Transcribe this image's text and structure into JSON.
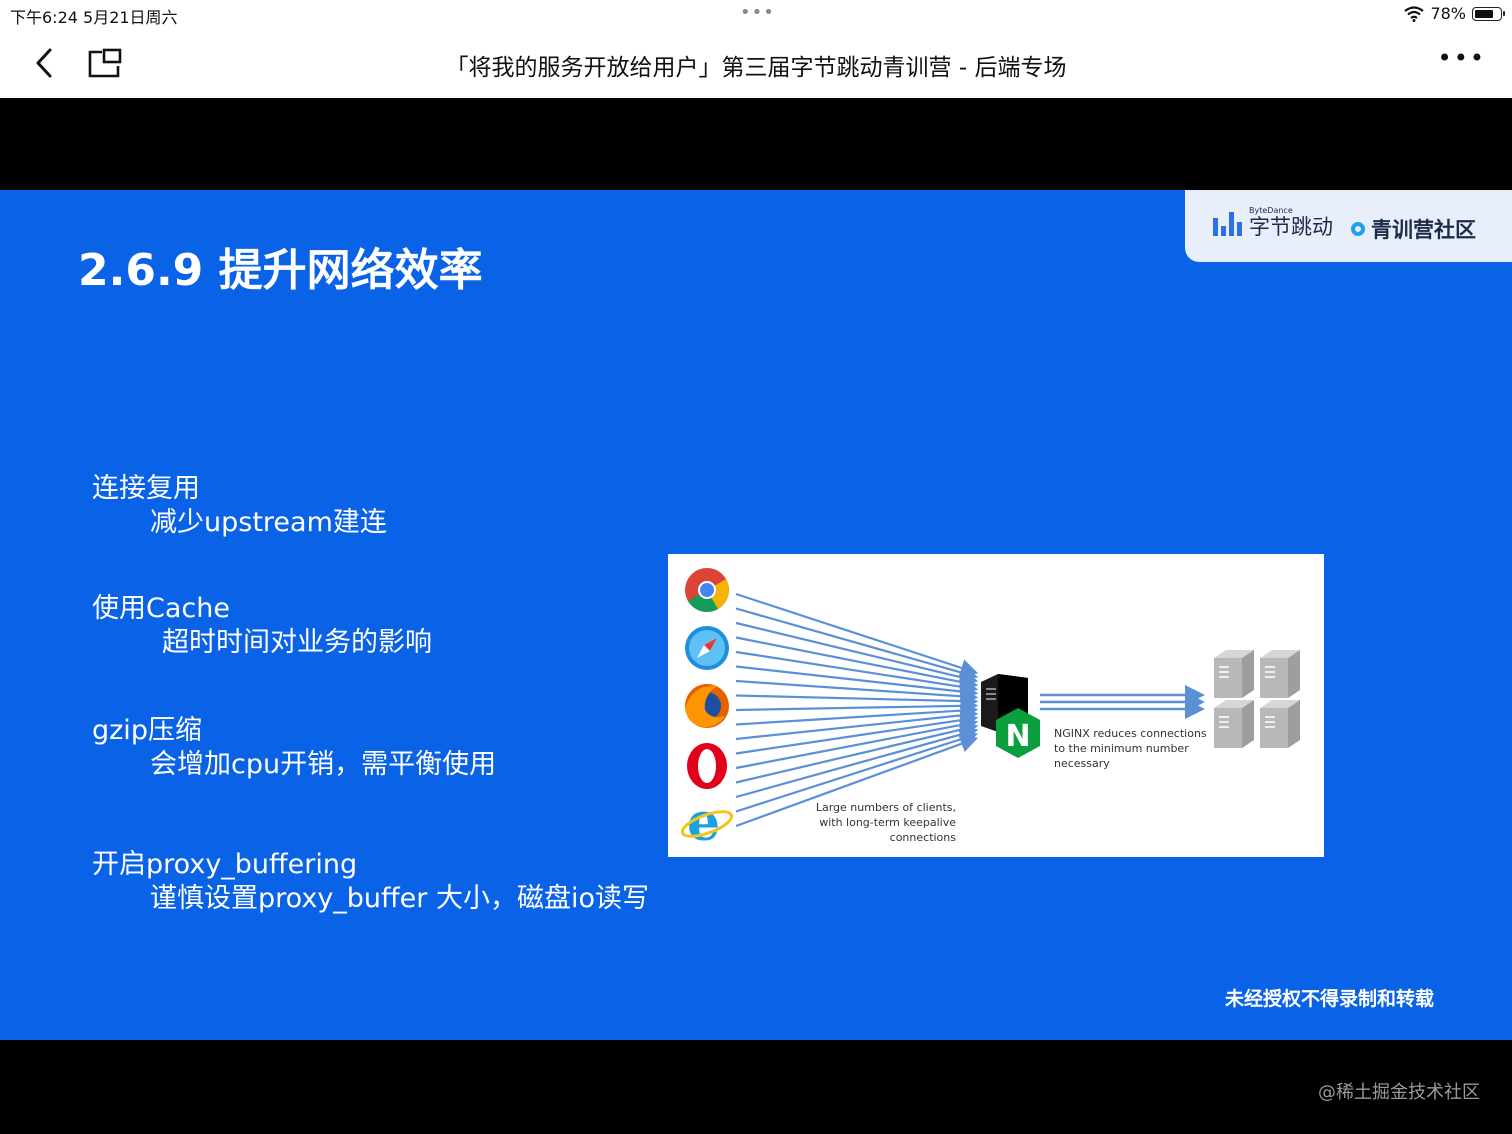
{
  "status_bar": {
    "time": "下午6:24   5月21日周六",
    "battery": "78%",
    "battery_level": 0.78
  },
  "nav": {
    "title": "「将我的服务开放给用户」第三届字节跳动青训营 - 后端专场",
    "back_icon": "chevron-left-icon",
    "pip_icon": "picture-in-picture-icon",
    "more_icon": "more-dots-icon"
  },
  "slide": {
    "title": "2.6.9 提升网络效率",
    "brand": {
      "bytedance_en": "ByteDance",
      "bytedance_cn": "字节跳动",
      "community": "青训营社区"
    },
    "items": [
      {
        "heading": "连接复用",
        "detail": "减少upstream建连"
      },
      {
        "heading": "使用Cache",
        "detail": "超时时间对业务的影响"
      },
      {
        "heading": "gzip压缩",
        "detail": "会增加cpu开销，需平衡使用"
      },
      {
        "heading": "开启proxy_buffering",
        "detail": "谨慎设置proxy_buffer 大小，磁盘io读写"
      }
    ],
    "diagram": {
      "clients_caption_line1": "Large numbers of clients,",
      "clients_caption_line2": "with long-term keepalive connections",
      "nginx_caption_line1": "NGINX reduces connections",
      "nginx_caption_line2": "to the minimum number",
      "nginx_caption_line3": "necessary",
      "nginx_letter": "N",
      "browsers": [
        "chrome-icon",
        "safari-icon",
        "firefox-icon",
        "opera-icon",
        "ie-icon"
      ]
    },
    "watermark": "未经授权不得录制和转载"
  },
  "corner_watermark": "@稀土掘金技术社区",
  "colors": {
    "slide_bg": "#0a63e6",
    "arrow": "#5b8fd6",
    "nginx_green": "#0b9e3c"
  }
}
